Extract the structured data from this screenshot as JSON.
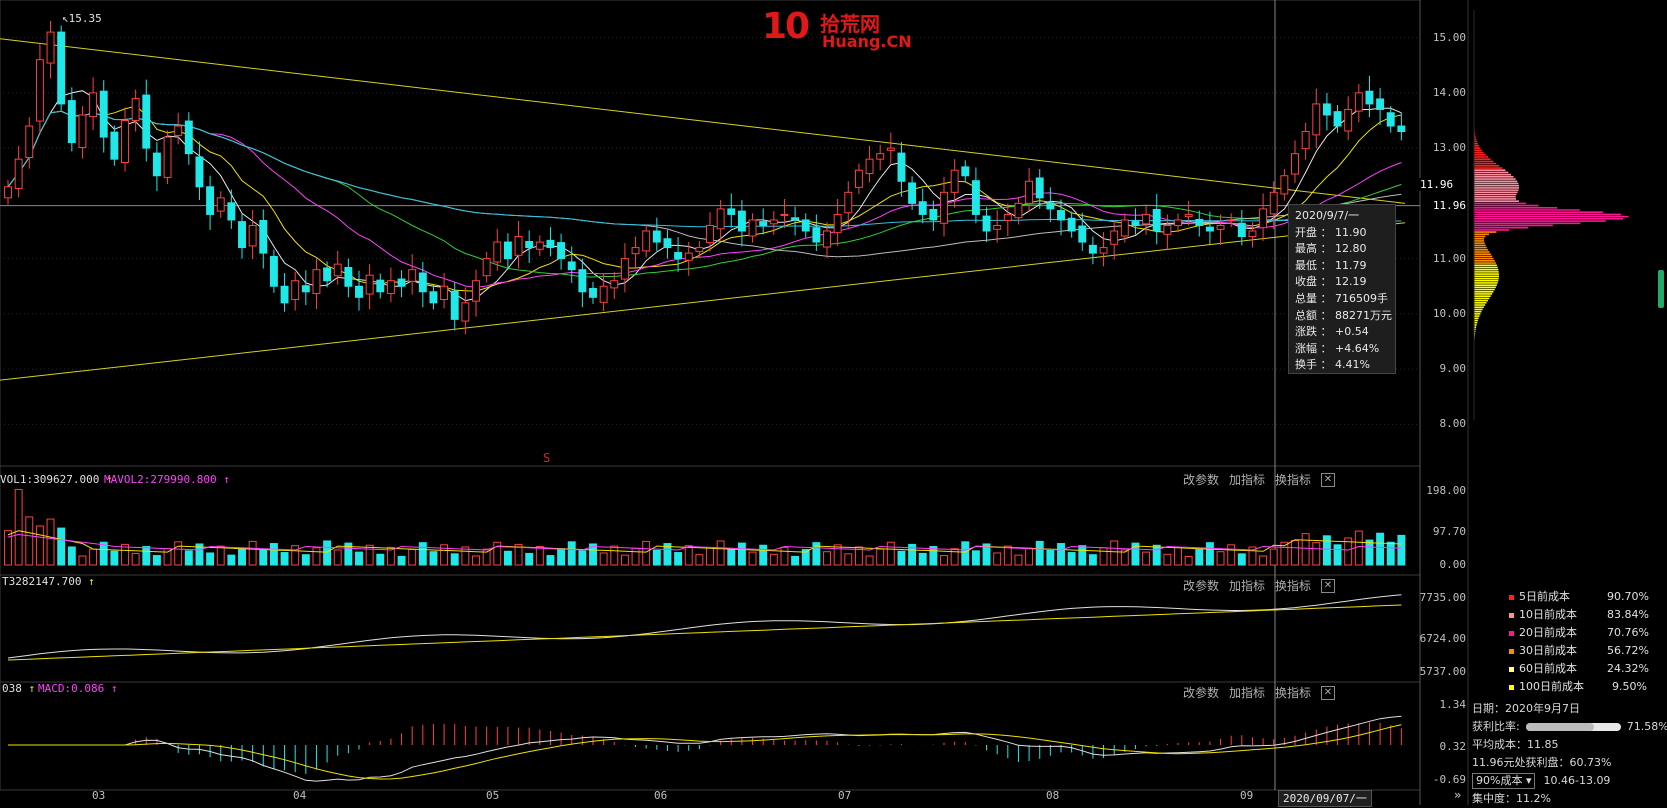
{
  "logo": {
    "number": "10",
    "cn": "拾荒网",
    "en": "Huang.CN"
  },
  "peak_label": "15.35",
  "signal_marker": "S",
  "price_axis": [
    "15.00",
    "14.00",
    "13.00",
    "11.96",
    "11.00",
    "10.00",
    "9.00",
    "8.00"
  ],
  "current_price": "11.96",
  "tooltip": {
    "date": "2020/9/7/一",
    "rows": [
      {
        "label": "开盘",
        "value": "11.90"
      },
      {
        "label": "最高",
        "value": "12.80"
      },
      {
        "label": "最低",
        "value": "11.79"
      },
      {
        "label": "收盘",
        "value": "12.19"
      },
      {
        "label": "总量",
        "value": "716509手"
      },
      {
        "label": "总额",
        "value": "88271万元"
      },
      {
        "label": "涨跌",
        "value": "+0.54"
      },
      {
        "label": "涨幅",
        "value": "+4.64%"
      },
      {
        "label": "换手",
        "value": "4.41%"
      }
    ]
  },
  "panel_buttons": {
    "modify": "改参数",
    "add": "加指标",
    "switch": "换指标",
    "close": "✕"
  },
  "vol_panel": {
    "vol1": "VOL1:309627.000",
    "vol1_arrow": "↑",
    "mavol2": "MAVOL2:279990.800",
    "mavol2_arrow": "↑",
    "axis": [
      "198.00",
      "97.70",
      "0.00"
    ]
  },
  "obv_panel": {
    "label": "T3282147.700",
    "arrow": "↑",
    "axis": [
      "7735.00",
      "6724.00",
      "5737.00"
    ]
  },
  "macd_panel": {
    "dea": "038",
    "dea_arrow": "↑",
    "macd": "MACD:0.086",
    "macd_arrow": "↑",
    "axis": [
      "1.34",
      "0.32",
      "-0.69"
    ]
  },
  "months": [
    "03",
    "04",
    "05",
    "06",
    "07",
    "08",
    "09"
  ],
  "cursor_date": "2020/09/07/一",
  "nav_arrow": "»",
  "cost_legend": [
    {
      "name": "5日前成本",
      "value": "90.70%",
      "color": "#ff2020"
    },
    {
      "name": "10日前成本",
      "value": "83.84%",
      "color": "#ff8fa0"
    },
    {
      "name": "20日前成本",
      "value": "70.76%",
      "color": "#ff1493"
    },
    {
      "name": "30日前成本",
      "value": "56.72%",
      "color": "#ff8c00"
    },
    {
      "name": "60日前成本",
      "value": "24.32%",
      "color": "#ffff80"
    },
    {
      "name": "100日前成本",
      "value": "9.50%",
      "color": "#ffff00"
    }
  ],
  "chip_info": {
    "date_label": "日期：2020年9月7日",
    "profit_label": "获利比率:",
    "profit_value": "71.58%",
    "profit_fraction": 0.7158,
    "avg_cost": "平均成本：11.85",
    "price_profit": "11.96元处获利盘：60.73%",
    "select": "90%成本",
    "cost_range": "10.46-13.09",
    "concentration": "集中度：11.2%"
  },
  "chart_data": {
    "type": "candlestick",
    "title": "",
    "price_ylim": [
      7.5,
      15.5
    ],
    "months": [
      "03",
      "04",
      "05",
      "06",
      "07",
      "08",
      "09"
    ],
    "close": [
      12.3,
      12.8,
      13.4,
      14.6,
      15.1,
      13.8,
      13.1,
      13.6,
      14.0,
      13.2,
      12.8,
      13.5,
      13.9,
      13.0,
      12.5,
      13.2,
      13.4,
      12.9,
      12.3,
      11.8,
      12.1,
      11.7,
      11.2,
      11.6,
      11.1,
      10.5,
      10.2,
      10.6,
      10.4,
      10.8,
      10.6,
      10.9,
      10.5,
      10.3,
      10.7,
      10.4,
      10.6,
      10.5,
      10.8,
      10.4,
      10.2,
      10.5,
      9.9,
      10.2,
      10.6,
      11.0,
      11.3,
      11.0,
      11.4,
      11.2,
      11.3,
      11.2,
      11.0,
      10.8,
      10.4,
      10.3,
      10.5,
      10.6,
      11.0,
      11.2,
      11.5,
      11.3,
      11.2,
      11.0,
      11.1,
      11.2,
      11.6,
      11.9,
      11.8,
      11.5,
      11.7,
      11.6,
      11.7,
      11.8,
      11.7,
      11.5,
      11.3,
      11.5,
      11.8,
      12.2,
      12.6,
      12.8,
      12.9,
      13.0,
      12.4,
      12.0,
      11.8,
      11.7,
      12.2,
      12.6,
      12.5,
      11.8,
      11.5,
      11.6,
      11.8,
      12.0,
      12.4,
      12.1,
      11.9,
      11.7,
      11.5,
      11.3,
      11.1,
      11.2,
      11.5,
      11.7,
      11.6,
      11.8,
      11.5,
      11.6,
      11.7,
      11.8,
      11.6,
      11.5,
      11.6,
      11.7,
      11.4,
      11.5,
      11.9,
      12.2,
      12.5,
      12.9,
      13.3,
      13.8,
      13.6,
      13.4,
      13.7,
      14.0,
      13.8,
      13.7,
      13.4,
      13.3
    ],
    "avg_cost": 11.85,
    "vol_axis": [
      0,
      198
    ],
    "macd_axis": [
      -0.69,
      1.34
    ]
  }
}
